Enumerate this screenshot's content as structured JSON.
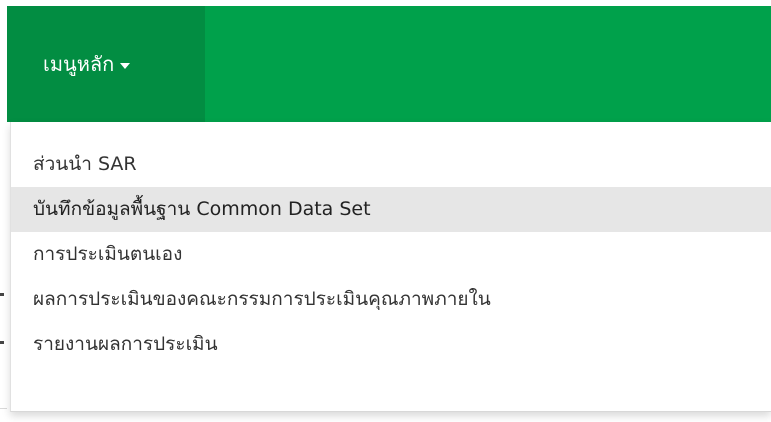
{
  "navbar": {
    "menu_toggle_label": "เมนูหลัก",
    "caret_icon": "caret-down-icon"
  },
  "dropdown": {
    "items": [
      {
        "label": "ส่วนนำ SAR"
      },
      {
        "label": "บันทึกข้อมูลพื้นฐาน Common Data Set",
        "highlighted": true
      },
      {
        "label": "การประเมินตนเอง"
      },
      {
        "label": "ผลการประเมินของคณะกรรมการประเมินคุณภาพภายใน"
      },
      {
        "label": "รายงานผลการประเมิน"
      }
    ]
  },
  "colors": {
    "navbar_green": "#00a14b",
    "toggle_dark_green": "#028d42",
    "highlight_gray": "#e6e6e6",
    "text_dark": "#333333"
  }
}
